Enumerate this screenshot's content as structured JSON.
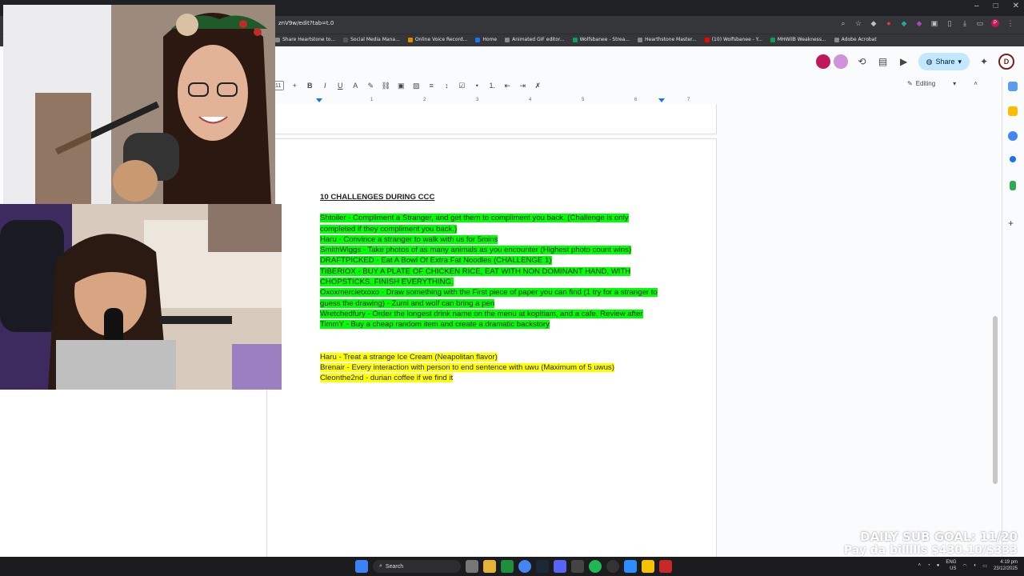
{
  "browser": {
    "url_fragment": "znV9w/edit?tab=t.0",
    "bookmarks": [
      {
        "label": "Share Heartstone to...",
        "color": "#888"
      },
      {
        "label": "Social Media Mana...",
        "color": "#555"
      },
      {
        "label": "Online Voice Record...",
        "color": "#e58a00"
      },
      {
        "label": "Home",
        "color": "#1877f2"
      },
      {
        "label": "Animated GIF editor...",
        "color": "#888"
      },
      {
        "label": "Wolfsbanee - Strea...",
        "color": "#0f9d58"
      },
      {
        "label": "Hearthstone Master...",
        "color": "#888"
      },
      {
        "label": "(10) Wolfsbanee - Y...",
        "color": "#ff0000"
      },
      {
        "label": "MHWilB Weakness...",
        "color": "#0f9d58"
      },
      {
        "label": "Adobe Acrobat",
        "color": "#888"
      }
    ]
  },
  "docs": {
    "share_label": "Share",
    "user_initial": "D",
    "font_size": "11",
    "editing_label": "Editing",
    "ruler_marks": [
      "1",
      "2",
      "3",
      "4",
      "5",
      "6",
      "7"
    ]
  },
  "document": {
    "title": "10 CHALLENGES DURING CCC",
    "green_lines": [
      "Shtoiler - Compliment a Stranger, and get them to compliment you back. (Challenge is only",
      "completed if they compliment you back.)",
      "Haru - Convince a stranger to walk with us for 5mins",
      "SmithWiggs - Take photos of as many animals as you encounter (Highest photo count wins)",
      "DRAFTPICKED - Eat A Bowl Of Extra Fat Noodles (CHALLENGE 1)",
      "TIBERIOX - BUY A PLATE OF CHICKEN RICE, EAT WITH NON DOMINANT HAND, WITH",
      "CHOPSTICKS. FINISH EVERYTHING.",
      "Oxoxmercietxoxo - Draw something with the First piece of paper you can find (1 try for a stranger to",
      "guess the drawing) - Zumi and wolf can bring a pen",
      "Wretchedfury - Order the longest drink name on the menu at kopitiam, and a cafe. Review after",
      "TimmY - Buy a cheap random item and create a dramatic backstory"
    ],
    "yellow_lines": [
      "Haru - Treat a strange Ice Cream (Neapolitan flavor)",
      "Brenair - Every interaction with person to end sentence with uwu (Maximum of 5 uwus)",
      "Cleonthe2nd - durian coffee if we find it"
    ]
  },
  "overlay": {
    "goal": "DAILY SUB GOAL: 11/20",
    "pay": "Pay da billllls $430.10/$333"
  },
  "taskbar": {
    "search_label": "Search",
    "lang": "ENG",
    "region": "US",
    "time": "4:19 pm",
    "date": "23/12/2025"
  }
}
